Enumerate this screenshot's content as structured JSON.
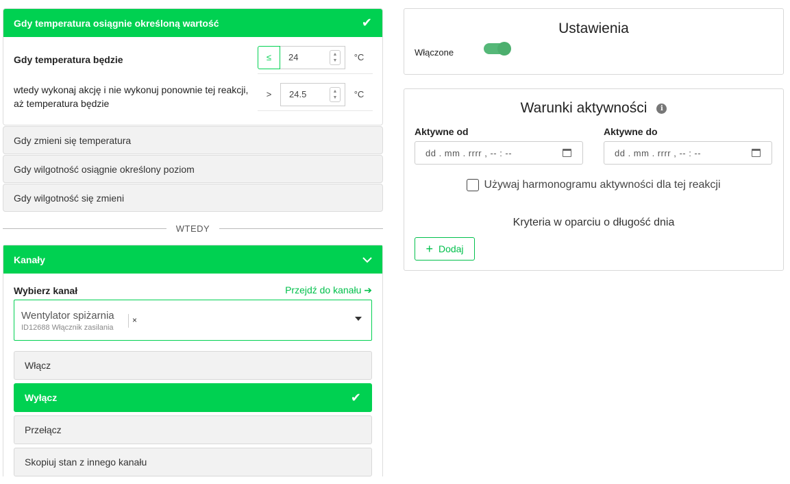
{
  "trigger": {
    "title": "Gdy temperatura osiągnie określoną wartość",
    "condition_label": "Gdy temperatura będzie",
    "condition_operator": "≤",
    "condition_value": "24",
    "condition_unit": "°C",
    "reset_label": "wtedy wykonaj akcję i nie wykonuj ponownie tej reakcji, aż temperatura będzie",
    "reset_operator": ">",
    "reset_value": "24.5",
    "reset_unit": "°C"
  },
  "other_triggers": [
    "Gdy zmieni się temperatura",
    "Gdy wilgotność osiągnie określony poziom",
    "Gdy wilgotność się zmieni"
  ],
  "divider": "WTEDY",
  "channels": {
    "title": "Kanały",
    "select_label": "Wybierz kanał",
    "goto_link": "Przejdź do kanału",
    "selected_name": "Wentylator spiżarnia",
    "selected_sub": "ID12688 Włącznik zasilania",
    "remove": "×",
    "actions": [
      "Włącz",
      "Wyłącz",
      "Przełącz",
      "Skopiuj stan z innego kanału"
    ],
    "active_action": "Wyłącz"
  },
  "settings": {
    "title": "Ustawienia",
    "enabled_label": "Włączone",
    "enabled": true
  },
  "activity": {
    "title": "Warunki aktywności",
    "from_label": "Aktywne od",
    "to_label": "Aktywne do",
    "datetime_placeholder": "dd . mm . rrrr ,  -- : --",
    "schedule_label": "Używaj harmonogramu aktywności dla tej reakcji",
    "criteria_label": "Kryteria w oparciu o długość dnia",
    "add_button": "Dodaj"
  },
  "colors": {
    "accent": "#00d151",
    "link": "#00c04b"
  }
}
